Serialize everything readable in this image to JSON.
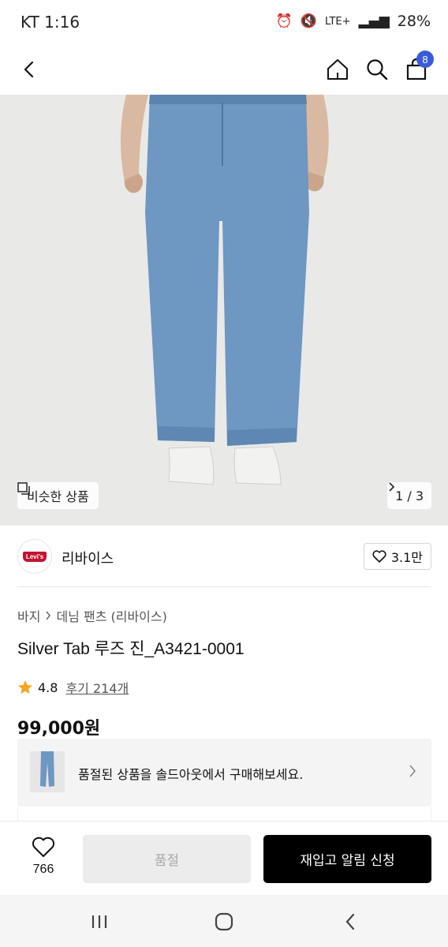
{
  "status_bar": {
    "carrier": "KT 1:16",
    "network": "LTE+",
    "battery": "28%"
  },
  "header": {
    "cart_count": "8",
    "icons": [
      "back-icon",
      "home-icon",
      "search-icon",
      "cart-icon"
    ]
  },
  "hero": {
    "similar_label": "비슷한 상품",
    "pager": "1 / 3"
  },
  "brand": {
    "logo_text": "Levi's",
    "name": "리바이스",
    "likes": "3.1만"
  },
  "product": {
    "breadcrumb": [
      "바지",
      "데님 팬츠 (리바이스)"
    ],
    "title": "Silver Tab 루즈 진_A3421-0001",
    "rating": "4.8",
    "reviews": "후기 214개",
    "price": "99,000원"
  },
  "soldout_card": {
    "message": "품절된 상품을 솔드아웃에서 구매해보세요."
  },
  "action_bar": {
    "wish_count": "766",
    "soldout_label": "품절",
    "notify_label": "재입고 알림 신청"
  },
  "colors": {
    "accent": "#3a5bd9",
    "primary_button": "#000000",
    "disabled_button": "#ececec",
    "star": "#f5a623",
    "denim": "#6e97c2"
  }
}
